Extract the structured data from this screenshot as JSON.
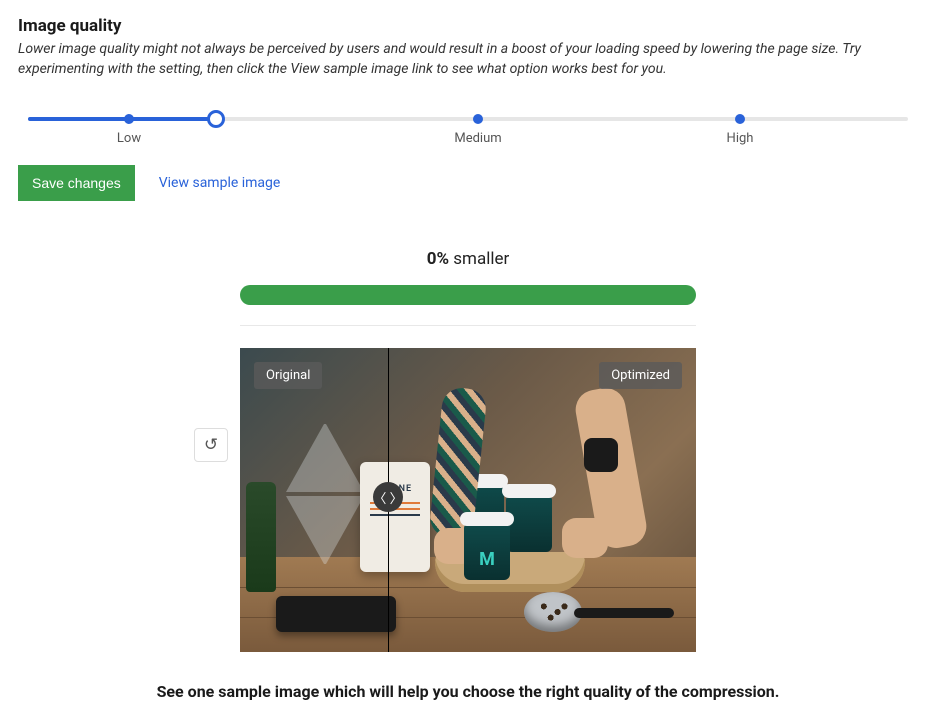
{
  "section": {
    "title": "Image quality",
    "description": "Lower image quality might not always be perceived by users and would result in a boost of your loading speed by lowering the page size. Try experimenting with the setting, then click the View sample image link to see what option works best for you."
  },
  "slider": {
    "labels": {
      "low": "Low",
      "medium": "Medium",
      "high": "High"
    }
  },
  "actions": {
    "save_label": "Save changes",
    "view_sample_label": "View sample image"
  },
  "result": {
    "percent": "0%",
    "suffix": " smaller"
  },
  "compare": {
    "original_label": "Original",
    "optimized_label": "Optimized"
  },
  "caption": "See one sample image which will help you choose the right quality of the compression.",
  "icons": {
    "refresh_glyph": "↺",
    "drag_glyph": "〈 〉"
  }
}
